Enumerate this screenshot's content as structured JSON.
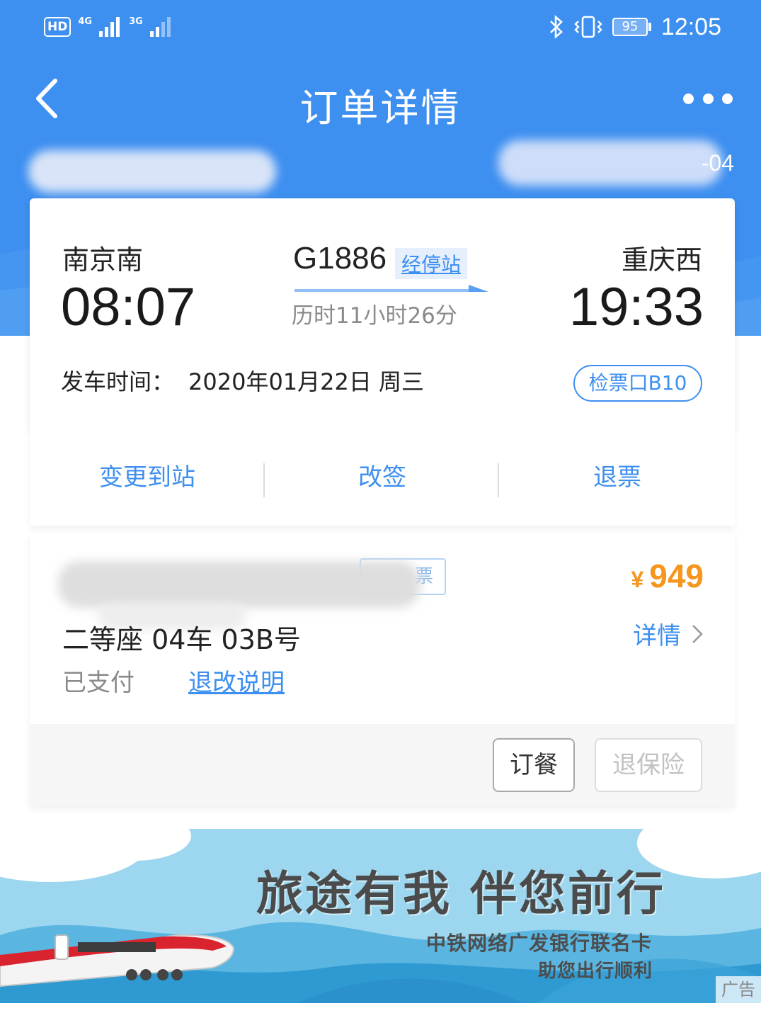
{
  "status_bar": {
    "hd_label": "HD",
    "net1": "4G",
    "net2": "3G",
    "battery": "95",
    "time": "12:05"
  },
  "header": {
    "title": "订单详情",
    "order_suffix": "-04"
  },
  "trip": {
    "from_station": "南京南",
    "to_station": "重庆西",
    "depart_time": "08:07",
    "arrive_time": "19:33",
    "train_no": "G1886",
    "stops_link": "经停站",
    "duration": "历时11小时26分",
    "depart_label": "发车时间：",
    "depart_date": "2020年01月22日 周三",
    "gate": "检票口B10"
  },
  "actions": {
    "change_station": "变更到站",
    "reschedule": "改签",
    "refund": "退票"
  },
  "passenger": {
    "ticket_type_tail": "票",
    "price_symbol": "¥",
    "price": "949",
    "seat": "二等座 04车 03B号",
    "detail_link": "详情",
    "pay_status": "已支付",
    "rules_link": "退改说明",
    "meal_button": "订餐",
    "insurance_button": "退保险"
  },
  "ad": {
    "title": "旅途有我 伴您前行",
    "sub1": "中铁网络广发银行联名卡",
    "sub2": "助您出行顺利",
    "tag": "广告"
  },
  "colors": {
    "primary": "#3d8ff0",
    "price": "#f5961e"
  }
}
